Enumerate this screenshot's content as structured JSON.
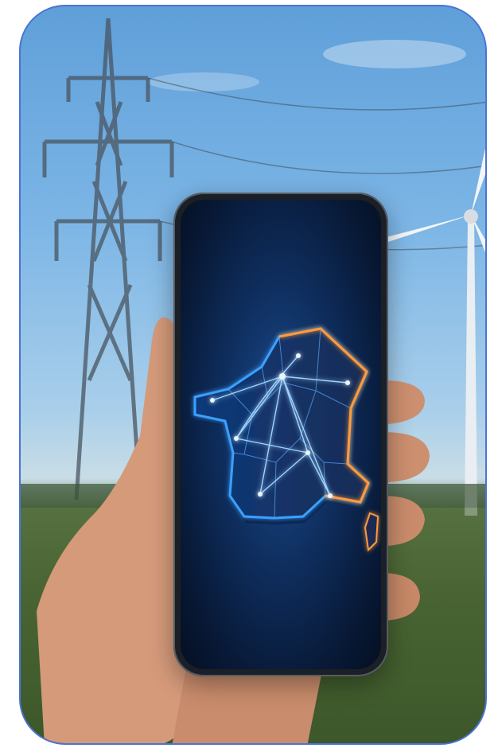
{
  "scene": {
    "description_icons": [
      "electricity-pylon",
      "wind-turbine",
      "hand",
      "smartphone",
      "france-map"
    ],
    "colors": {
      "frame_border": "#4a74d4",
      "sky": "#7db6e6",
      "grass": "#4f6a39",
      "map_glow_blue": "#3aa0ff",
      "map_glow_orange": "#ff9a3a"
    }
  }
}
